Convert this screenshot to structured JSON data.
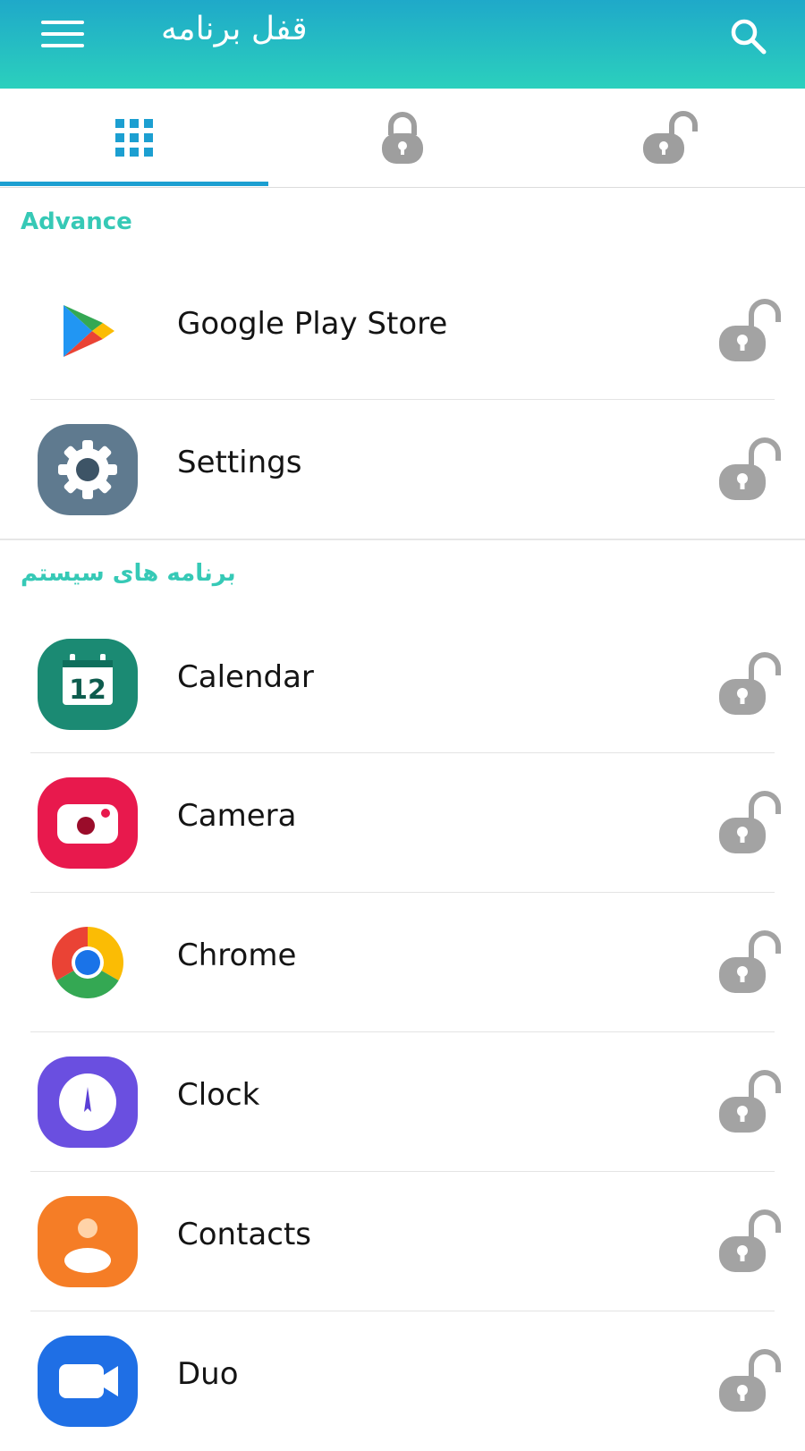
{
  "header": {
    "title": "قفل برنامه",
    "menu_icon": "hamburger-icon",
    "search_icon": "search-icon",
    "gradient": [
      "#1fa9c9",
      "#2bd0bd"
    ]
  },
  "tabs": [
    {
      "icon": "grid-icon",
      "selected": true
    },
    {
      "icon": "lock-icon",
      "selected": false
    },
    {
      "icon": "unlock-icon",
      "selected": false
    }
  ],
  "sections": {
    "advance": "Advance",
    "system": "برنامه های سیستم"
  },
  "apps": [
    {
      "name": "Google Play Store",
      "icon": "play-store-icon",
      "locked": false
    },
    {
      "name": "Settings",
      "icon": "settings-gear-icon",
      "locked": false
    },
    {
      "name": "Calendar",
      "icon": "calendar-icon",
      "locked": false,
      "badge": "12"
    },
    {
      "name": "Camera",
      "icon": "camera-icon",
      "locked": false
    },
    {
      "name": "Chrome",
      "icon": "chrome-icon",
      "locked": false
    },
    {
      "name": "Clock",
      "icon": "clock-icon",
      "locked": false
    },
    {
      "name": "Contacts",
      "icon": "contacts-icon",
      "locked": false
    },
    {
      "name": "Duo",
      "icon": "duo-video-icon",
      "locked": false
    }
  ],
  "colors": {
    "accent": "#36c9b6",
    "tab_indicator": "#1c9fd1",
    "lock_gray": "#9e9e9e"
  }
}
